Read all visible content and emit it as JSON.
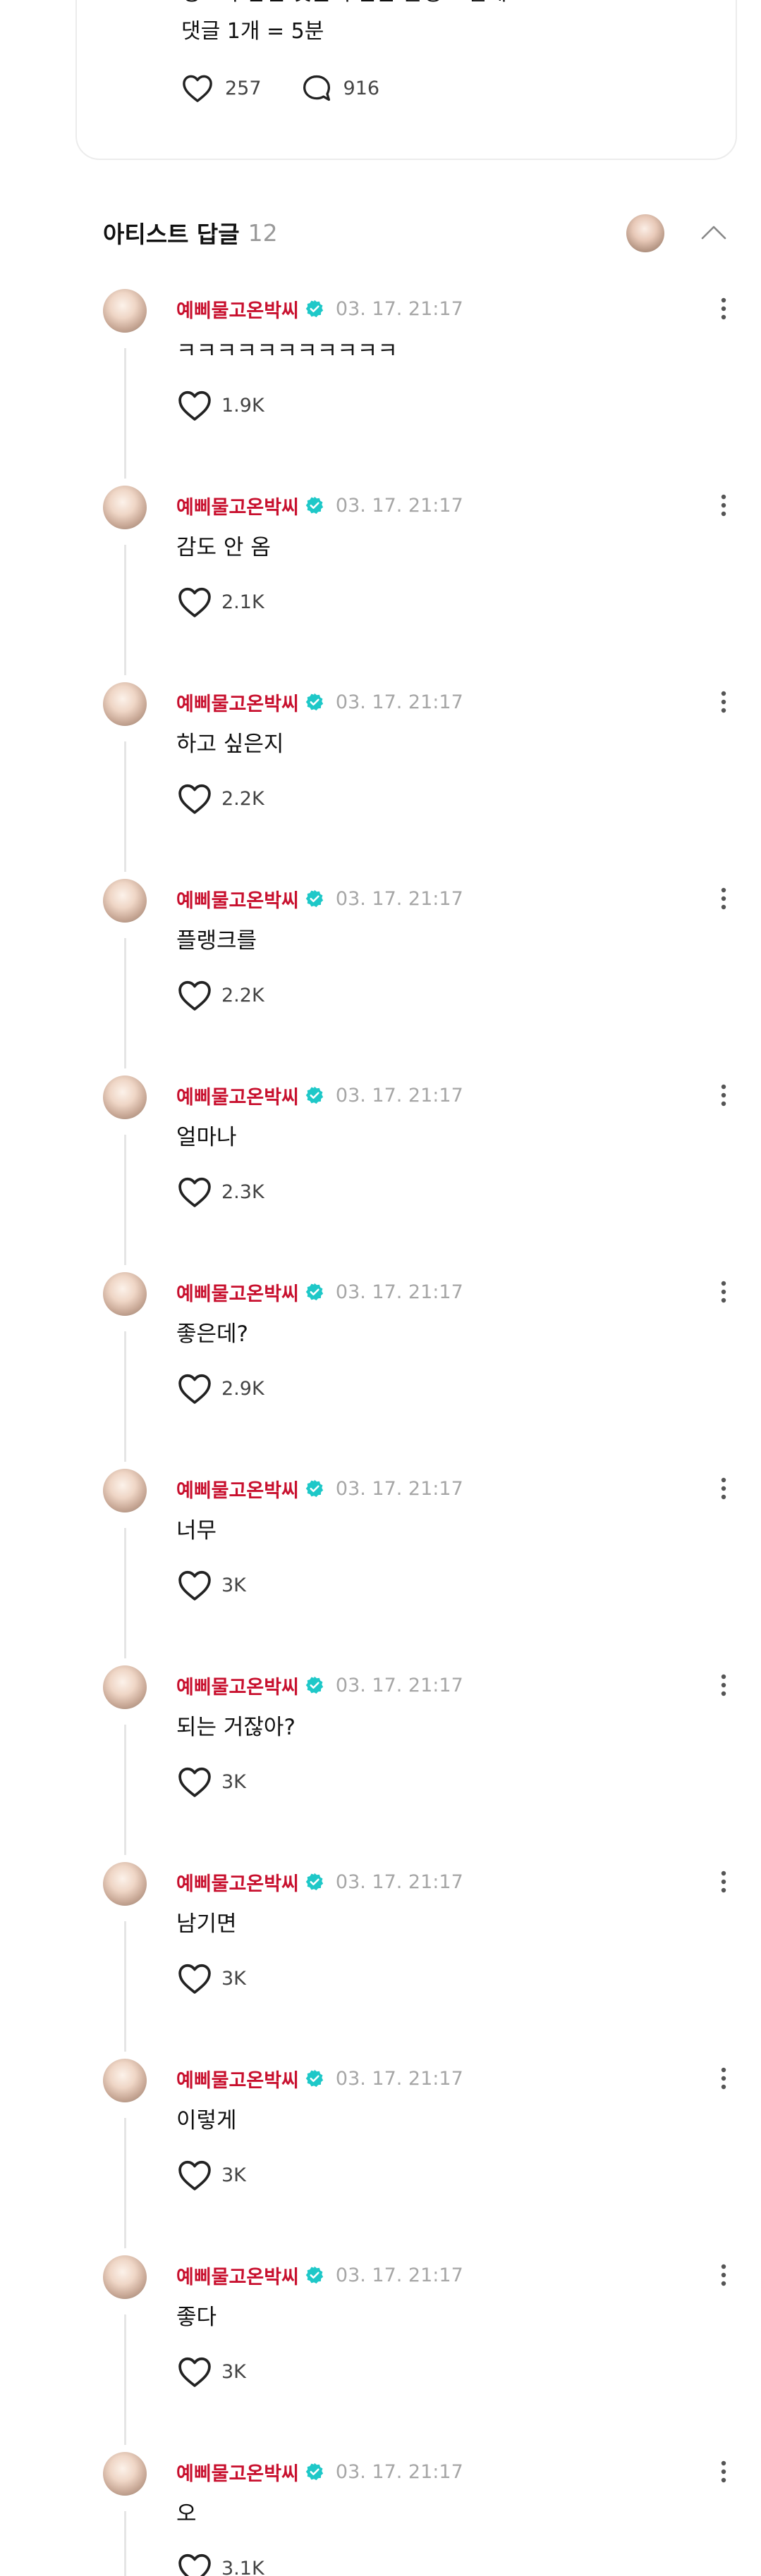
{
  "post": {
    "text_line1": "성호가 남긴 댓글 수만큼 플랭크 할게!ㅎ",
    "text_line2": "댓글 1개 = 5분",
    "like_count": "257",
    "comment_count": "916"
  },
  "section": {
    "title": "아티스트 답글",
    "count": "12"
  },
  "colors": {
    "artist_name": "#c8102e",
    "verified_badge": "#1ec8c8",
    "timestamp": "#a6a6a6"
  },
  "replies": [
    {
      "name": "예삐물고온박씨",
      "time": "03. 17. 21:17",
      "text": "ㅋㅋㅋㅋㅋㅋㅋㅋㅋㅋㅋ",
      "likes": "1.9K"
    },
    {
      "name": "예삐물고온박씨",
      "time": "03. 17. 21:17",
      "text": "감도 안 옴",
      "likes": "2.1K"
    },
    {
      "name": "예삐물고온박씨",
      "time": "03. 17. 21:17",
      "text": "하고 싶은지",
      "likes": "2.2K"
    },
    {
      "name": "예삐물고온박씨",
      "time": "03. 17. 21:17",
      "text": "플랭크를",
      "likes": "2.2K"
    },
    {
      "name": "예삐물고온박씨",
      "time": "03. 17. 21:17",
      "text": "얼마나",
      "likes": "2.3K"
    },
    {
      "name": "예삐물고온박씨",
      "time": "03. 17. 21:17",
      "text": "좋은데?",
      "likes": "2.9K"
    },
    {
      "name": "예삐물고온박씨",
      "time": "03. 17. 21:17",
      "text": "너무",
      "likes": "3K"
    },
    {
      "name": "예삐물고온박씨",
      "time": "03. 17. 21:17",
      "text": "되는 거잖아?",
      "likes": "3K"
    },
    {
      "name": "예삐물고온박씨",
      "time": "03. 17. 21:17",
      "text": "남기면",
      "likes": "3K"
    },
    {
      "name": "예삐물고온박씨",
      "time": "03. 17. 21:17",
      "text": "이렇게",
      "likes": "3K"
    },
    {
      "name": "예삐물고온박씨",
      "time": "03. 17. 21:17",
      "text": "좋다",
      "likes": "3K"
    },
    {
      "name": "예삐물고온박씨",
      "time": "03. 17. 21:17",
      "text": "오",
      "likes": "3.1K"
    }
  ]
}
